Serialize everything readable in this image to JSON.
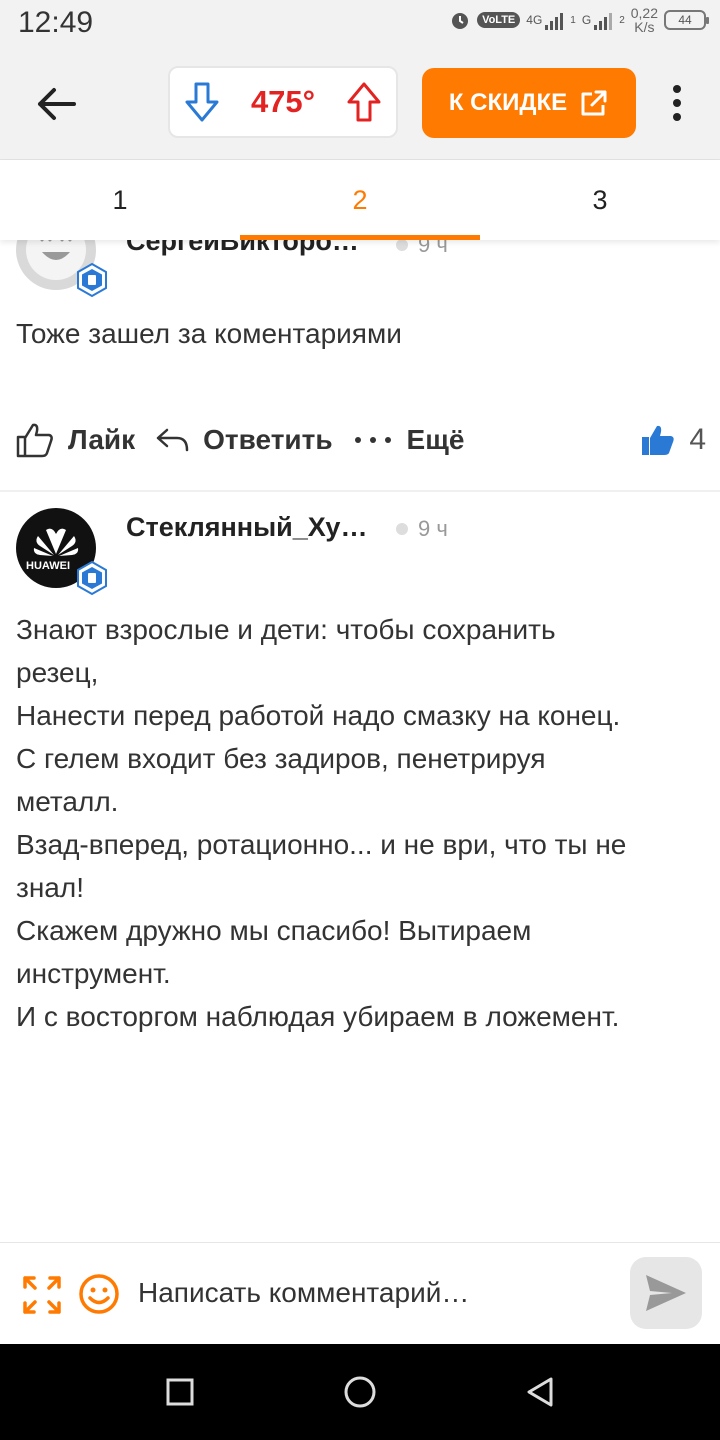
{
  "status_bar": {
    "time": "12:49",
    "volte": "VoLTE",
    "net_4g": "4G",
    "net_g": "G",
    "sim1": "1",
    "sim2": "2",
    "speed_value": "0,22",
    "speed_unit": "K/s",
    "battery": "44"
  },
  "header": {
    "rating": "475°",
    "cta_label": "К СКИДКЕ",
    "accent_color": "#ff7a00",
    "rating_color": "#e32222"
  },
  "tabs": [
    {
      "label": "1",
      "active": false
    },
    {
      "label": "2",
      "active": true
    },
    {
      "label": "3",
      "active": false
    }
  ],
  "comments": [
    {
      "author": "СергейВикторо…",
      "time": "9 ч",
      "text": "Тоже зашел за коментариями",
      "like_label": "Лайк",
      "reply_label": "Ответить",
      "more_label": "Ещё",
      "likes": "4"
    },
    {
      "author": "Стеклянный_Ху…",
      "time": "9 ч",
      "avatar_text": "HUAWEI",
      "lines": [
        "Знают взрослые и дети: чтобы сохранить",
        "резец,",
        "Нанести перед работой надо смазку на конец.",
        "С гелем входит без задиров, пенетрируя",
        "металл.",
        "Взад-вперед, ротационно... и не ври, что ты не",
        "знал!",
        "Скажем дружно мы спасибо! Вытираем",
        "инструмент.",
        "И с восторгом наблюдая убираем в ложемент."
      ]
    }
  ],
  "composer": {
    "placeholder": "Написать комментарий…"
  }
}
